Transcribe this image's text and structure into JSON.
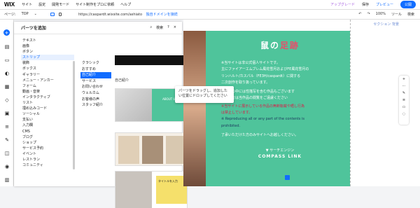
{
  "topbar": {
    "logo": "WIX",
    "menu": [
      "サイト",
      "設定",
      "開発モード",
      "サイト制作をプロに依頼",
      "ヘルプ"
    ],
    "upgrade": "アップグレード",
    "save": "保存",
    "preview": "プレビュー",
    "publish": "公開"
  },
  "urlbar": {
    "page_label": "ページ:",
    "page_value": "TOP",
    "url": "https://caspardt.wixsite.com/ashiato",
    "connect_domain": "独自ドメインを接続",
    "zoom": "100%",
    "tools": "ツール",
    "search": "検索"
  },
  "panel": {
    "title": "パーツを追加",
    "search_label": "検索",
    "help": "?",
    "close": "×",
    "categories": [
      "テキスト",
      "画像",
      "ボタン",
      "ストリップ",
      "装飾",
      "ボックス",
      "ギャラリー",
      "メニュー・アンカー",
      "フォーム",
      "動画・音楽",
      "インタラクティブ",
      "リスト",
      "埋め込みコード",
      "ソーシャル",
      "支払い",
      "入力欄",
      "CMS",
      "ブログ",
      "ショップ",
      "サービス予約",
      "イベント",
      "レストラン",
      "コミュニティ"
    ],
    "selected_category": "ストリップ",
    "subcategories": [
      "クラシック",
      "おすすめ",
      "自己紹介",
      "サービス",
      "お問い合わせ",
      "ウェルカム",
      "お客様の声",
      "スタッフ紹介"
    ],
    "selected_subcategory": "自己紹介",
    "grid_title": "自己紹介",
    "thumb1_text": "ABOUT US",
    "thumb3_text": "タイトルを入力"
  },
  "tooltip": "パーツをドラッグし、追加したい位置にドロップしてください",
  "canvas": {
    "section_label": "セクション",
    "section_label2": "背景",
    "title_a": "鼠の",
    "title_b": "足跡",
    "lines": [
      "※当サイトは非公式個人サイトです。",
      "主にファイアーエムブレム風花雪月およびFE風花雪月の",
      "リンハルト/カスパル（FE3H/caspardt）に関する",
      "二次創作を取り扱っています。"
    ],
    "line_partial": "テンツの中には性描写を含む作品もございます",
    "line_partial2": "未満の方は当作品の閲覧をご遠慮ください",
    "red1": "※当サイトに展示している作品の無断転載や晒し行為",
    "red2": "は禁止しています。",
    "en1": "※ Reproducing all or any part of the contents is",
    "en2": "prohibited.",
    "thanks": "了承いただけた方のみサイトへお越しください。",
    "footer": "▼ サーチエンジン",
    "compass": "COMPASS LINK"
  }
}
